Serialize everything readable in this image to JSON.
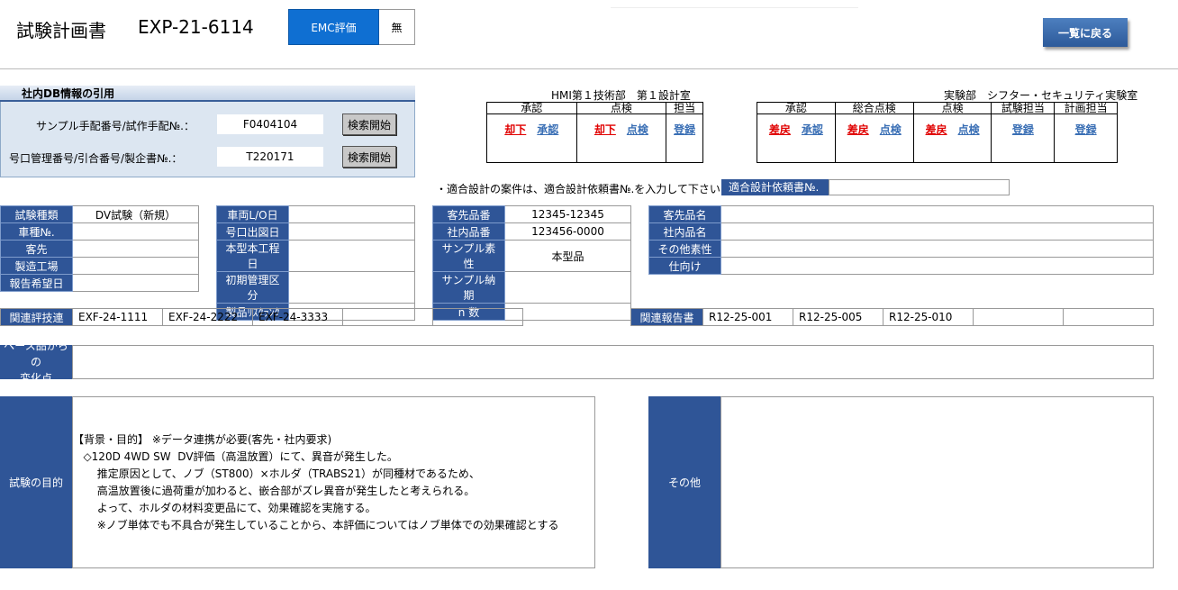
{
  "header": {
    "title": "試験計画書",
    "doc_no": "EXP-21-6114",
    "emc_label": "EMC評価",
    "emc_value": "無",
    "back_button": "一覧に戻る"
  },
  "db_panel": {
    "title": "社内DB情報の引用",
    "rows": [
      {
        "label": "サンプル手配番号/試作手配№.：",
        "value": "F0404104",
        "button": "検索開始"
      },
      {
        "label": "号口管理番号/引合番号/製企書№.：",
        "value": "T220171",
        "button": "検索開始"
      }
    ]
  },
  "approval_left": {
    "dept": "HMI第１技術部　第１設計室",
    "columns": [
      "承認",
      "点検",
      "担当"
    ],
    "cells": [
      {
        "red": "却下",
        "blue": "承認"
      },
      {
        "red": "却下",
        "blue": "点検"
      },
      {
        "red": "",
        "blue": "登録"
      }
    ]
  },
  "approval_right": {
    "dept": "実験部　シフター・セキュリティ実験室",
    "columns": [
      "承認",
      "総合点検",
      "点検",
      "試験担当",
      "計画担当"
    ],
    "cells": [
      {
        "red": "差戻",
        "blue": "承認"
      },
      {
        "red": "差戻",
        "blue": "点検"
      },
      {
        "red": "差戻",
        "blue": "点検"
      },
      {
        "red": "",
        "blue": "登録"
      },
      {
        "red": "",
        "blue": "登録"
      }
    ]
  },
  "request": {
    "note": "・適合設計の案件は、適合設計依頼書№.を入力して下さい",
    "label": "適合設計依頼書№.",
    "value": ""
  },
  "grid1": [
    {
      "label": "試験種類",
      "value": "DV試験（新規）"
    },
    {
      "label": "車種№.",
      "value": ""
    },
    {
      "label": "客先",
      "value": ""
    },
    {
      "label": "製造工場",
      "value": ""
    },
    {
      "label": "報告希望日",
      "value": ""
    }
  ],
  "grid2": [
    {
      "label": "車両L/O日",
      "value": ""
    },
    {
      "label": "号口出図日",
      "value": ""
    },
    {
      "label": "本型本工程日",
      "value": ""
    },
    {
      "label": "初期管理区分",
      "value": ""
    },
    {
      "label": "製品ﾘｽｸﾗﾝｸ",
      "value": ""
    }
  ],
  "grid3": [
    {
      "label": "客先品番",
      "value": "12345-12345"
    },
    {
      "label": "社内品番",
      "value": "123456-0000"
    },
    {
      "label": "サンプル素性",
      "value": "本型品"
    },
    {
      "label": "サンプル納期",
      "value": ""
    },
    {
      "label": "n 数",
      "value": ""
    }
  ],
  "grid4": [
    {
      "label": "客先品名",
      "value": ""
    },
    {
      "label": "社内品名",
      "value": ""
    },
    {
      "label": "その他素性",
      "value": ""
    },
    {
      "label": "仕向け",
      "value": ""
    }
  ],
  "related_eval": {
    "label": "関連評技連",
    "values": [
      "EXF-24-1111",
      "EXF-24-2222",
      "EXF-24-3333",
      "",
      ""
    ]
  },
  "related_report": {
    "label": "関連報告書",
    "values": [
      "R12-25-001",
      "R12-25-005",
      "R12-25-010",
      "",
      ""
    ]
  },
  "change_point": {
    "label_line1": "ベース品からの",
    "label_line2": "変化点",
    "value": ""
  },
  "purpose": {
    "label": "試験の目的",
    "lines": [
      "【背景・目的】 ※データ連携が必要(客先・社内要求)",
      "   ◇120D 4WD SW  DV評価（高温放置）にて、異音が発生した。",
      "       推定原因として、ノブ（ST800）×ホルダ（TRABS21）が同種材であるため、",
      "       高温放置後に過荷重が加わると、嵌合部がズレ異音が発生したと考えられる。",
      "       よって、ホルダの材料変更品にて、効果確認を実施する。",
      "       ※ノブ単体でも不具合が発生していることから、本評価についてはノブ単体での効果確認とする"
    ]
  },
  "other": {
    "label": "その他",
    "value": ""
  }
}
